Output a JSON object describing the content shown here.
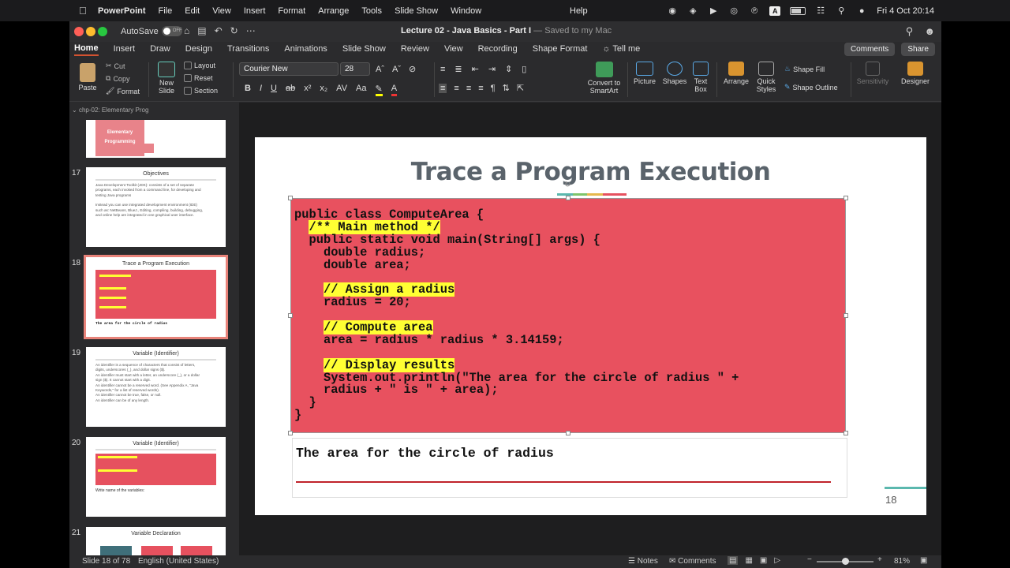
{
  "menubar": {
    "app": "PowerPoint",
    "items": [
      "File",
      "Edit",
      "View",
      "Insert",
      "Format",
      "Arrange",
      "Tools",
      "Slide Show",
      "Window"
    ],
    "help": "Help",
    "clock": "Fri 4 Oct  20:14"
  },
  "titlebar": {
    "autosave": "AutoSave",
    "toggle": "OFF",
    "doc_name": "Lecture 02 - Java Basics - Part I",
    "saved": " — Saved to my Mac"
  },
  "ribbon_tabs": [
    "Home",
    "Insert",
    "Draw",
    "Design",
    "Transitions",
    "Animations",
    "Slide Show",
    "Review",
    "View",
    "Recording",
    "Shape Format",
    "Tell me"
  ],
  "ribbon_right": {
    "comments": "Comments",
    "share": "Share"
  },
  "ribbon": {
    "paste": "Paste",
    "cut": "Cut",
    "copy": "Copy",
    "format": "Format",
    "new_slide": "New Slide",
    "layout": "Layout",
    "reset": "Reset",
    "section": "Section",
    "font": "Courier New",
    "font_size": "28",
    "convert": "Convert to SmartArt",
    "picture": "Picture",
    "shapes": "Shapes",
    "text_box": "Text Box",
    "arrange": "Arrange",
    "quick_styles": "Quick Styles",
    "shape_fill": "Shape Fill",
    "shape_outline": "Shape Outline",
    "sensitivity": "Sensitivity",
    "designer": "Designer"
  },
  "panel": {
    "section": "chp-02: Elementary Prog",
    "thumbs": [
      {
        "num": "",
        "title": "Elementary Programming"
      },
      {
        "num": "17",
        "title": "Objectives",
        "lines": [
          "Java Development Toolkit (JDK): consists of a set of separate",
          "programs, each invoked from a command line, for developing and",
          "testing Java programs",
          "",
          "Instead you can use integrated development environment (IDE)",
          "such as: NetBeans, BlueJ., Editing, compiling, building, debugging,",
          "and online help are integrated in one graphical user interface."
        ]
      },
      {
        "num": "18",
        "title": "Trace a Program Execution",
        "caption": "The area for the circle of radius"
      },
      {
        "num": "19",
        "title": "Variable (Identifier)",
        "lines": [
          "An identifier is a sequence of characters that consist of letters,",
          "digits, underscores (_), and dollar signs ($).",
          "An identifier must start with a letter, an underscore (_), or a dollar",
          "sign ($). It cannot start with a digit.",
          "An identifier cannot be a reserved word. (See Appendix A, \"Java",
          "Keywords,\" for a list of reserved words).",
          "An identifier cannot be true, false, or null.",
          "An identifier can be of any length."
        ]
      },
      {
        "num": "20",
        "title": "Variable (Identifier)",
        "caption": "Write name of the variables:"
      },
      {
        "num": "21",
        "title": "Variable Declaration"
      }
    ]
  },
  "slide": {
    "title": "Trace a Program Execution",
    "code": [
      {
        "indent": "",
        "text": "public class ComputeArea {",
        "hl": false
      },
      {
        "indent": "  ",
        "text": "/** Main method */",
        "hl": true
      },
      {
        "indent": "  ",
        "text": "public static void main(String[] args) {",
        "hl": false
      },
      {
        "indent": "    ",
        "text": "double radius;",
        "hl": false
      },
      {
        "indent": "    ",
        "text": "double area;",
        "hl": false
      },
      {
        "indent": "",
        "text": "",
        "hl": false
      },
      {
        "indent": "    ",
        "text": "// Assign a radius",
        "hl": true
      },
      {
        "indent": "    ",
        "text": "radius = 20;",
        "hl": false
      },
      {
        "indent": "",
        "text": "",
        "hl": false
      },
      {
        "indent": "    ",
        "text": "// Compute area",
        "hl": true
      },
      {
        "indent": "    ",
        "text": "area = radius * radius * 3.14159;",
        "hl": false
      },
      {
        "indent": "",
        "text": "",
        "hl": false
      },
      {
        "indent": "    ",
        "text": "// Display results",
        "hl": true
      },
      {
        "indent": "    ",
        "text": "System.out.println(\"The area for the circle of radius \" +",
        "hl": false
      },
      {
        "indent": "    ",
        "text": "radius + \" is \" + area);",
        "hl": false
      },
      {
        "indent": "  ",
        "text": "}",
        "hl": false
      },
      {
        "indent": "",
        "text": "}",
        "hl": false
      }
    ],
    "output": "The area for the circle of radius",
    "page_number": "18",
    "colors": {
      "code_bg": "#e8515f",
      "highlight": "#ffff33",
      "title": "#5a636b",
      "accent": "#5bb8ae",
      "underline": "#c0232b"
    }
  },
  "statusbar": {
    "slide_info": "Slide 18 of 78",
    "language": "English (United States)",
    "notes": "Notes",
    "comments": "Comments",
    "zoom": "81%",
    "zoom_level": 0.81
  }
}
